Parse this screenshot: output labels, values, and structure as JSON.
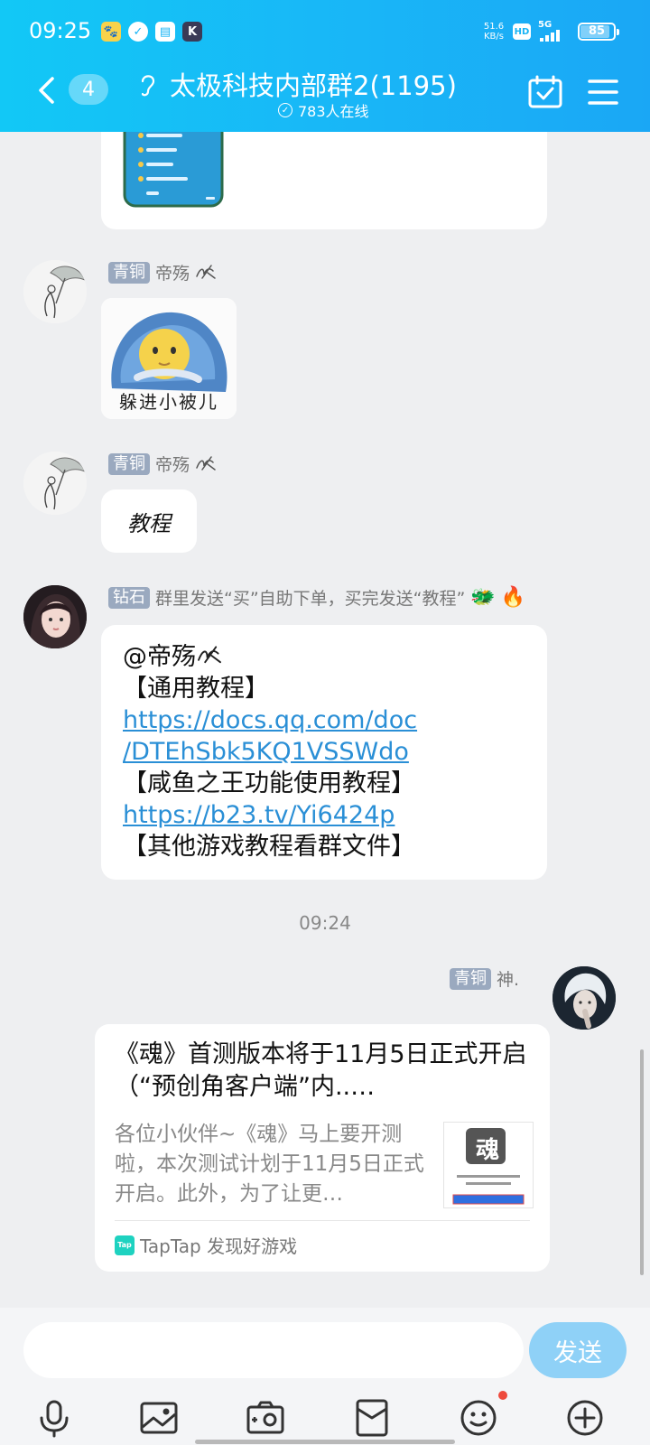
{
  "status_bar": {
    "time": "09:25",
    "net_speed_value": "51.6",
    "net_speed_unit": "KB/s",
    "hd": "HD",
    "signal_label": "5G",
    "battery": "85",
    "notification_icons": [
      "paw-icon",
      "check-circle-icon",
      "archive-icon",
      "k-app-icon"
    ]
  },
  "header": {
    "unread_count": "4",
    "group_title": "太极科技内部群2(1195)",
    "online_text": "783人在线",
    "background_colors": [
      "#12c8f6",
      "#1aa7f5"
    ]
  },
  "messages": [
    {
      "id": "sticker",
      "rank": "青铜",
      "sender": "帝殇",
      "sticker_caption": "躲进小被儿"
    },
    {
      "id": "tutorial-request",
      "rank": "青铜",
      "sender": "帝殇",
      "text": "教程"
    },
    {
      "id": "bot-reply",
      "rank": "钻石",
      "sender": "群里发送“买”自助下单，买完发送“教程”",
      "lines": [
        "@帝殇",
        "【通用教程】",
        "https://docs.qq.com/doc",
        "/DTEhSbk5KQ1VSSWdo",
        "【咸鱼之王功能使用教程】",
        "https://b23.tv/Yi6424p",
        "【其他游戏教程看群文件】"
      ]
    },
    {
      "id": "share-card",
      "rank": "青铜",
      "sender": "神.",
      "card_title": "《魂》首测版本将于11月5日正式开启（“预创角客户端”内..…",
      "card_desc": "各位小伙伴~《魂》马上要开测啦，本次测试计划于11月5日正式开启。此外，为了让更…",
      "thumb_char": "魂",
      "source_logo": "Tap",
      "source": "TapTap 发现好游戏"
    }
  ],
  "time_separator": "09:24",
  "input": {
    "value": "",
    "placeholder": "",
    "send_label": "发送"
  },
  "toolbar_icons": [
    "microphone-icon",
    "image-icon",
    "camera-icon",
    "red-packet-icon",
    "emoji-icon",
    "plus-icon"
  ],
  "colors": {
    "accent": "#18b6f6",
    "link": "#2a8fd6",
    "rank_badge": "#9aa9bf",
    "send_button": "#8fd1f7",
    "notification_dot": "#ee4a3c"
  }
}
